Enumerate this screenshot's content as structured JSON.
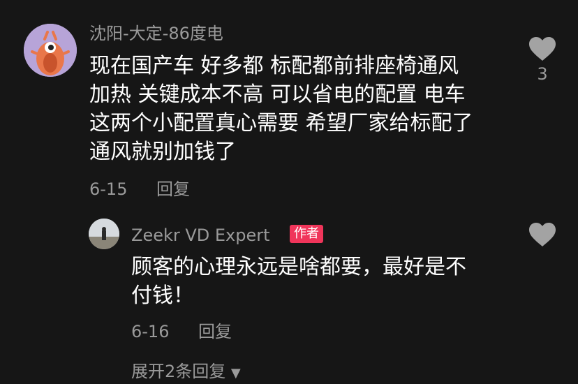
{
  "main_comment": {
    "username": "沈阳-大定-86度电",
    "text_lines": [
      "现在国产车 好多都 标配都前排座椅通风",
      "加热 关键成本不高 可以省电的配置 电车",
      "这两个小配置真心需要 希望厂家给标配了",
      "通风就别加钱了"
    ],
    "date": "6-15",
    "reply_label": "回复",
    "like_count": "3",
    "like_icon": "heart-icon"
  },
  "reply_comment": {
    "username": "Zeekr VD Expert",
    "badge": "作者",
    "text_lines": [
      "顾客的心理永远是啥都要，最好是不",
      "付钱！"
    ],
    "date": "6-16",
    "reply_label": "回复",
    "like_icon": "heart-icon"
  },
  "expand": {
    "label": "展开2条回复",
    "icon": "caret-down-icon"
  },
  "colors": {
    "background": "#161616",
    "secondary_text": "#9a9a9a",
    "badge": "#f0355a",
    "heart": "#a3a3a3"
  }
}
